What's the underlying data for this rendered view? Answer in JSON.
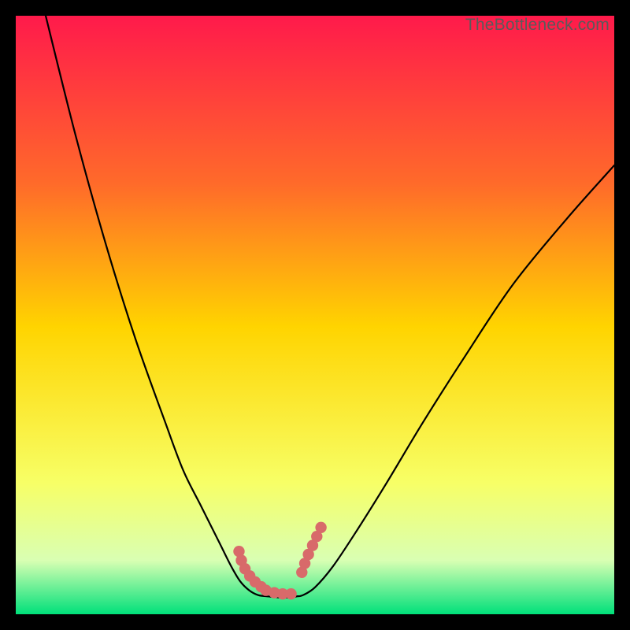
{
  "watermark": "TheBottleneck.com",
  "colors": {
    "gradient_top": "#ff1a4b",
    "gradient_mid_upper": "#ff6a2a",
    "gradient_mid": "#ffd400",
    "gradient_mid_lower": "#f7ff66",
    "gradient_lower": "#d9ffb3",
    "gradient_bottom": "#00e07a",
    "curve": "#000000",
    "marker": "#d86a6a",
    "background": "#000000"
  },
  "chart_data": {
    "type": "line",
    "title": "",
    "xlabel": "",
    "ylabel": "",
    "xlim": [
      0,
      100
    ],
    "ylim": [
      0,
      100
    ],
    "series": [
      {
        "name": "left-branch",
        "x": [
          5,
          10,
          15,
          20,
          25,
          28,
          31,
          34,
          36,
          37.5,
          39,
          40.5,
          42
        ],
        "y": [
          100,
          80,
          62,
          46,
          32,
          24,
          18,
          12,
          8,
          5.5,
          4,
          3.2,
          3
        ]
      },
      {
        "name": "right-branch",
        "x": [
          47,
          48,
          50,
          53,
          57,
          62,
          68,
          75,
          83,
          92,
          100
        ],
        "y": [
          3,
          3.2,
          4.5,
          8,
          14,
          22,
          32,
          43,
          55,
          66,
          75
        ]
      },
      {
        "name": "flat-minimum",
        "x": [
          42,
          44,
          46,
          47
        ],
        "y": [
          3,
          2.8,
          2.8,
          3
        ]
      }
    ],
    "markers_left": {
      "name": "dotted-left-near-min",
      "x": [
        37.3,
        37.7,
        38.3,
        39.1,
        40.0,
        41.0,
        41.8,
        43.2,
        44.6,
        46.0
      ],
      "y": [
        10.5,
        9.0,
        7.6,
        6.4,
        5.4,
        4.6,
        4.0,
        3.6,
        3.4,
        3.4
      ]
    },
    "markers_right": {
      "name": "dotted-right-near-min",
      "x": [
        47.8,
        48.3,
        48.9,
        49.6,
        50.3,
        51.0
      ],
      "y": [
        7.0,
        8.5,
        10.0,
        11.5,
        13.0,
        14.5
      ]
    },
    "annotations": []
  }
}
